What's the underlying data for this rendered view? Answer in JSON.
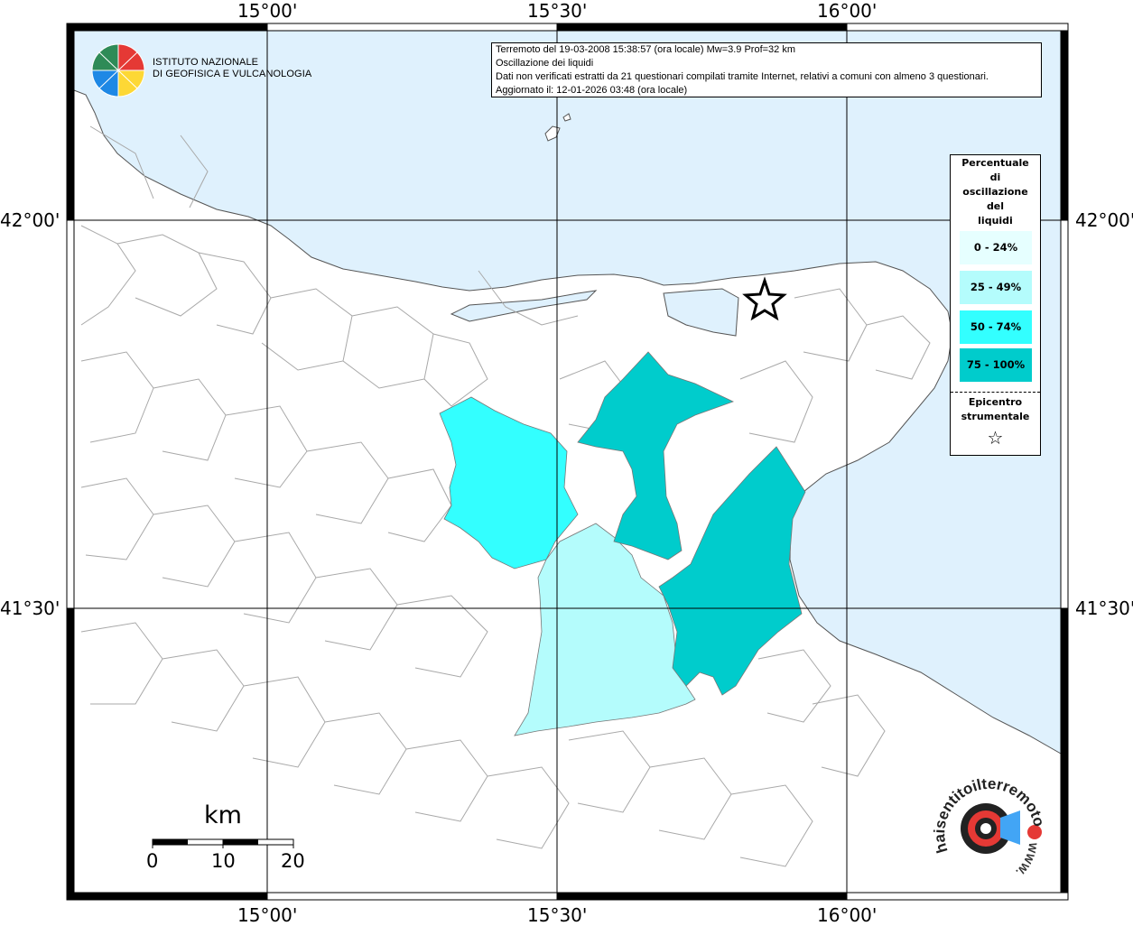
{
  "info": {
    "line1": "Terremoto del 19-03-2008 15:38:57 (ora locale) Mw=3.9 Prof=32 km",
    "line2": "Oscillazione dei liquidi",
    "line3": "Dati non verificati estratti da 21 questionari compilati tramite Internet, relativi a comuni con almeno 3 questionari.",
    "line4": "Aggiornato il: 12-01-2026 03:48 (ora locale)"
  },
  "legend": {
    "title_lines": [
      "Percentuale",
      "di",
      "oscillazione",
      "del",
      "liquidi"
    ],
    "classes": [
      {
        "label": "0 - 24%",
        "color": "#e6ffff"
      },
      {
        "label": "25 - 49%",
        "color": "#b4fcfc"
      },
      {
        "label": "50 - 74%",
        "color": "#33ffff"
      },
      {
        "label": "75 - 100%",
        "color": "#00cccc"
      }
    ],
    "epicenter_lines": [
      "Epicentro",
      "strumentale"
    ],
    "epicenter_symbol": "☆"
  },
  "axes": {
    "top": [
      "15°00'",
      "15°30'",
      "16°00'"
    ],
    "bottom": [
      "15°00'",
      "15°30'",
      "16°00'"
    ],
    "left": [
      "42°00'",
      "41°30'"
    ],
    "right": [
      "42°00'",
      "41°30'"
    ]
  },
  "scale": {
    "unit": "km",
    "labels": [
      "0",
      "10",
      "20"
    ]
  },
  "logos": {
    "ingv_line1": "ISTITUTO NAZIONALE",
    "ingv_line2": "DI GEOFISICA E VULCANOLOGIA",
    "hsit_text": "haisentitoilterremoto.it",
    "hsit_www": "WWW."
  },
  "colors": {
    "sea": "#dff1fd",
    "land": "#ffffff",
    "border": "#a0a0a0"
  }
}
